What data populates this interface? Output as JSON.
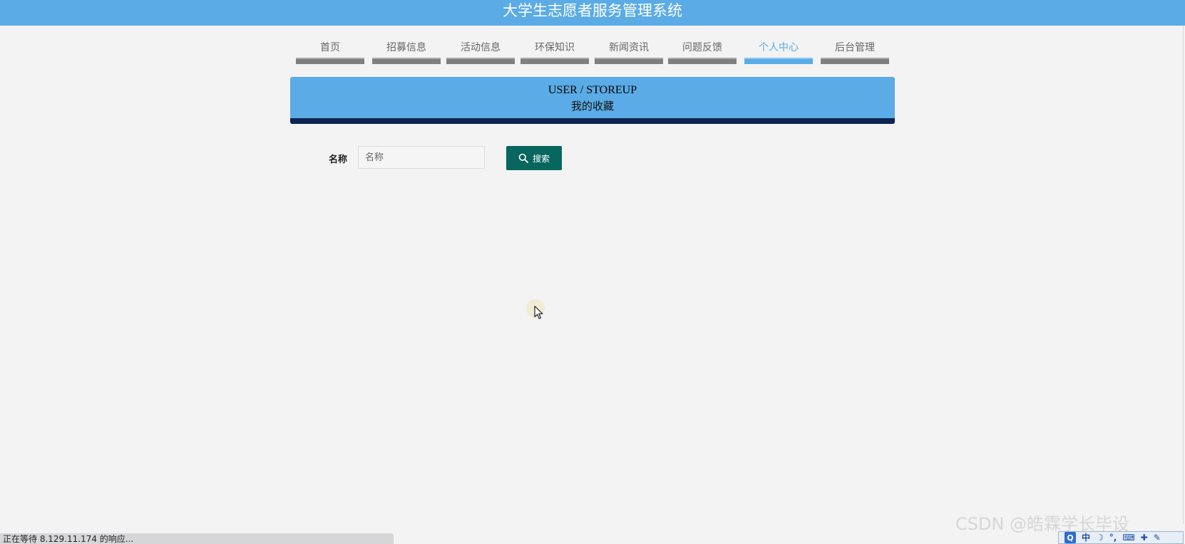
{
  "header": {
    "title": "大学生志愿者服务管理系统"
  },
  "nav": {
    "items": [
      {
        "label": "首页"
      },
      {
        "label": "招募信息"
      },
      {
        "label": "活动信息"
      },
      {
        "label": "环保知识"
      },
      {
        "label": "新闻资讯"
      },
      {
        "label": "问题反馈"
      },
      {
        "label": "个人中心",
        "active": true
      },
      {
        "label": "后台管理"
      }
    ]
  },
  "section": {
    "title_en": "USER / STOREUP",
    "title_cn": "我的收藏"
  },
  "search": {
    "label": "名称",
    "placeholder": "名称",
    "value": "",
    "button_label": "搜索"
  },
  "status_bar": {
    "text": "正在等待 8.129.11.174 的响应..."
  },
  "watermark": {
    "text": "CSDN @皓霖学长毕设"
  },
  "tray": {
    "items": [
      "中",
      "☽",
      "°,",
      "⌨",
      "✚",
      "✎"
    ]
  },
  "colors": {
    "header_bg": "#5aabe6",
    "active_nav": "#5aabe6",
    "banner_bottom": "#0d2350",
    "search_button": "#07665d",
    "page_bg": "#f3f3f3"
  }
}
